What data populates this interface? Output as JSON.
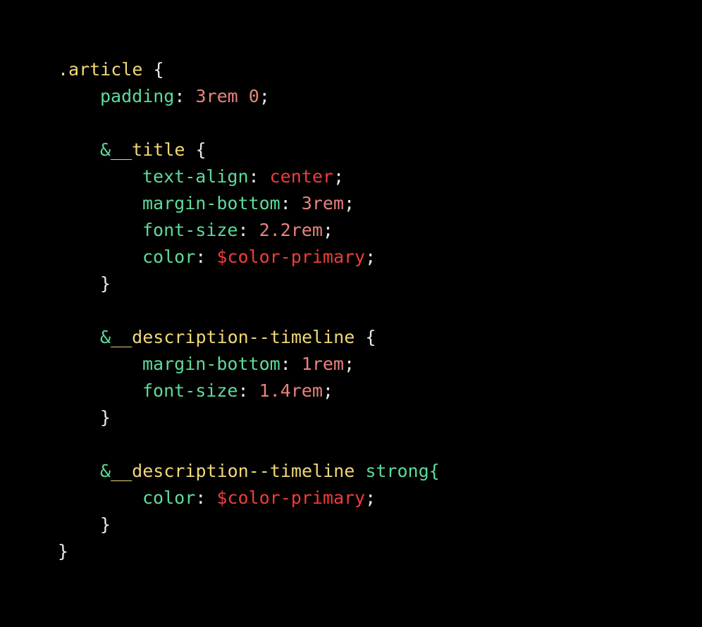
{
  "editor": {
    "background_color": "#000000",
    "language": "scss",
    "font_size_px": 25,
    "line_height_px": 38
  },
  "palette": {
    "selector": "#f0d878",
    "ampersand": "#5ddb9a",
    "element": "#5ddb9a",
    "property": "#5ddb9a",
    "number": "#e8837c",
    "keyword": "#f03c3c",
    "punctuation": "#e8e8e8",
    "background": "#000000"
  },
  "code": {
    "lines": [
      {
        "indent": 0,
        "tokens": [
          {
            "text": ".article",
            "type": "selector"
          },
          {
            "text": " ",
            "type": "punct"
          },
          {
            "text": "{",
            "type": "brace"
          }
        ]
      },
      {
        "indent": 1,
        "tokens": [
          {
            "text": "padding",
            "type": "property"
          },
          {
            "text": ": ",
            "type": "punct"
          },
          {
            "text": "3rem 0",
            "type": "number"
          },
          {
            "text": ";",
            "type": "punct"
          }
        ]
      },
      {
        "indent": 0,
        "tokens": []
      },
      {
        "indent": 1,
        "tokens": [
          {
            "text": "&",
            "type": "amp"
          },
          {
            "text": "__title",
            "type": "selector"
          },
          {
            "text": " ",
            "type": "punct"
          },
          {
            "text": "{",
            "type": "brace"
          }
        ]
      },
      {
        "indent": 2,
        "tokens": [
          {
            "text": "text-align",
            "type": "property"
          },
          {
            "text": ": ",
            "type": "punct"
          },
          {
            "text": "center",
            "type": "keyword"
          },
          {
            "text": ";",
            "type": "punct"
          }
        ]
      },
      {
        "indent": 2,
        "tokens": [
          {
            "text": "margin-bottom",
            "type": "property"
          },
          {
            "text": ": ",
            "type": "punct"
          },
          {
            "text": "3rem",
            "type": "number"
          },
          {
            "text": ";",
            "type": "punct"
          }
        ]
      },
      {
        "indent": 2,
        "tokens": [
          {
            "text": "font-size",
            "type": "property"
          },
          {
            "text": ": ",
            "type": "punct"
          },
          {
            "text": "2.2rem",
            "type": "number"
          },
          {
            "text": ";",
            "type": "punct"
          }
        ]
      },
      {
        "indent": 2,
        "tokens": [
          {
            "text": "color",
            "type": "property"
          },
          {
            "text": ": ",
            "type": "punct"
          },
          {
            "text": "$color-primary",
            "type": "keyword"
          },
          {
            "text": ";",
            "type": "punct"
          }
        ]
      },
      {
        "indent": 1,
        "tokens": [
          {
            "text": "}",
            "type": "brace"
          }
        ]
      },
      {
        "indent": 0,
        "tokens": []
      },
      {
        "indent": 1,
        "tokens": [
          {
            "text": "&",
            "type": "amp"
          },
          {
            "text": "__description--timeline",
            "type": "selector"
          },
          {
            "text": " ",
            "type": "punct"
          },
          {
            "text": "{",
            "type": "brace"
          }
        ]
      },
      {
        "indent": 2,
        "tokens": [
          {
            "text": "margin-bottom",
            "type": "property"
          },
          {
            "text": ": ",
            "type": "punct"
          },
          {
            "text": "1rem",
            "type": "number"
          },
          {
            "text": ";",
            "type": "punct"
          }
        ]
      },
      {
        "indent": 2,
        "tokens": [
          {
            "text": "font-size",
            "type": "property"
          },
          {
            "text": ": ",
            "type": "punct"
          },
          {
            "text": "1.4rem",
            "type": "number"
          },
          {
            "text": ";",
            "type": "punct"
          }
        ]
      },
      {
        "indent": 1,
        "tokens": [
          {
            "text": "}",
            "type": "brace"
          }
        ]
      },
      {
        "indent": 0,
        "tokens": []
      },
      {
        "indent": 1,
        "tokens": [
          {
            "text": "&",
            "type": "amp"
          },
          {
            "text": "__description--timeline",
            "type": "selector"
          },
          {
            "text": " ",
            "type": "punct"
          },
          {
            "text": "strong{",
            "type": "element"
          }
        ]
      },
      {
        "indent": 2,
        "tokens": [
          {
            "text": "color",
            "type": "property"
          },
          {
            "text": ": ",
            "type": "punct"
          },
          {
            "text": "$color-primary",
            "type": "keyword"
          },
          {
            "text": ";",
            "type": "punct"
          }
        ]
      },
      {
        "indent": 1,
        "tokens": [
          {
            "text": "}",
            "type": "brace"
          }
        ]
      },
      {
        "indent": 0,
        "tokens": [
          {
            "text": "}",
            "type": "brace"
          }
        ]
      }
    ]
  }
}
